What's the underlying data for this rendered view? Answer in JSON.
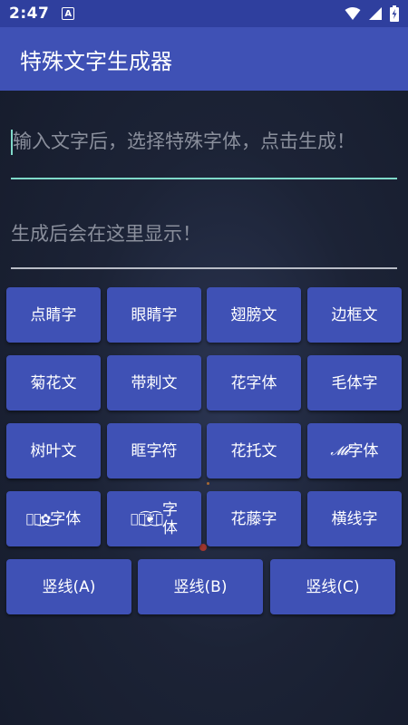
{
  "status_bar": {
    "time": "2:47",
    "a_icon": "A"
  },
  "app_bar": {
    "title": "特殊文字生成器"
  },
  "input": {
    "placeholder": "输入文字后，选择特殊字体，点击生成！",
    "value": ""
  },
  "output": {
    "placeholder_text": "生成后会在这里显示！"
  },
  "buttons": [
    {
      "label": "点睛字"
    },
    {
      "label": "眼睛字"
    },
    {
      "label": "翅膀文"
    },
    {
      "label": "边框文"
    },
    {
      "label": "菊花文"
    },
    {
      "label": "带刺文"
    },
    {
      "label": "花字体"
    },
    {
      "label": "毛体字"
    },
    {
      "label": "树叶文"
    },
    {
      "label": "眶字符"
    },
    {
      "label": "花托文"
    },
    {
      "label": "字体",
      "prefix": "𝓜𝓵"
    },
    {
      "label": "字体",
      "prefix": "ঔৣ͜✿͜"
    },
    {
      "label": "字\n体",
      "prefix": "ঔৣ͜͡❦͜͡ৣ"
    },
    {
      "label": "花藤字"
    },
    {
      "label": "横线字"
    },
    {
      "label": "竖线(A)"
    },
    {
      "label": "竖线(B)"
    },
    {
      "label": "竖线(C)"
    }
  ],
  "colors": {
    "app_bar": "#3f51b5",
    "status_bar": "#2f3f9e",
    "accent": "#7fd9c9",
    "button": "#3f51b5"
  }
}
